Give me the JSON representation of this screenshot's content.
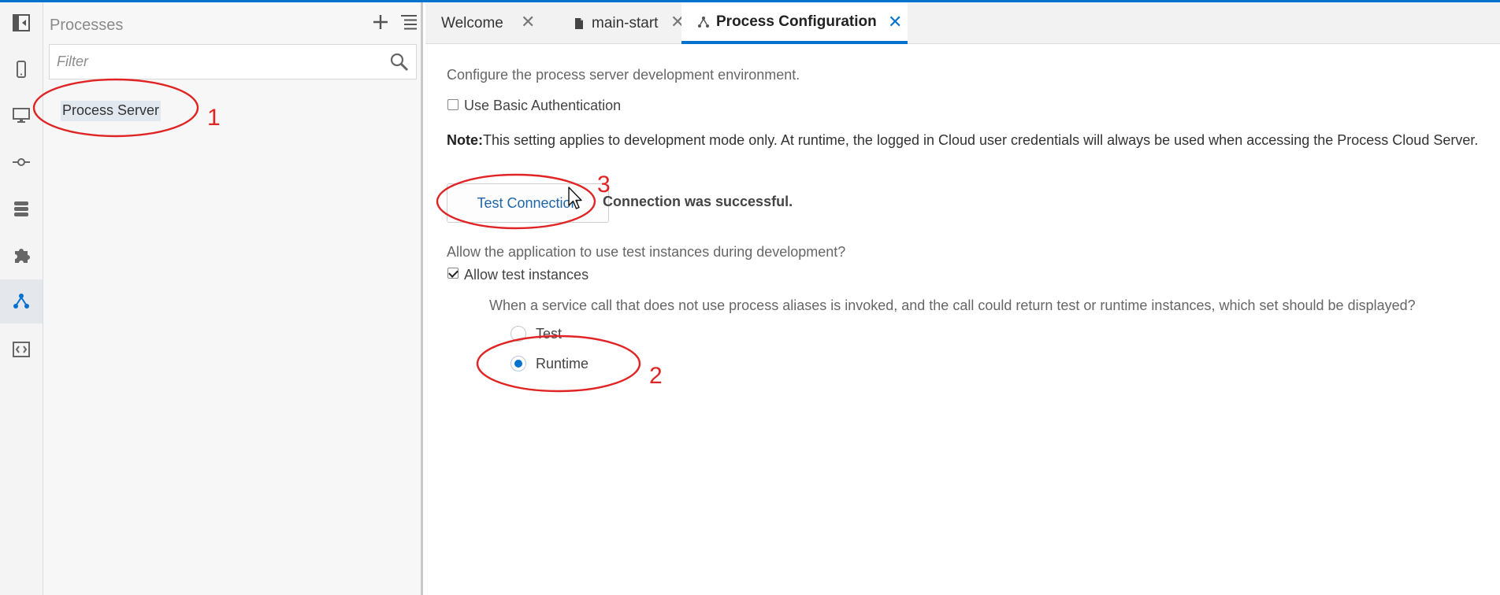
{
  "rail": {
    "items": [
      {
        "name": "toggle-panel-icon"
      },
      {
        "name": "mobile-icon"
      },
      {
        "name": "desktop-icon"
      },
      {
        "name": "service-icon"
      },
      {
        "name": "database-icon"
      },
      {
        "name": "puzzle-icon"
      },
      {
        "name": "processes-icon"
      },
      {
        "name": "code-icon"
      }
    ]
  },
  "panel": {
    "title": "Processes",
    "filter_placeholder": "Filter",
    "items": [
      {
        "label": "Process Server"
      }
    ]
  },
  "tabs": [
    {
      "label": "Welcome",
      "active": false
    },
    {
      "label": "main-start",
      "active": false
    },
    {
      "label": "Process Configuration",
      "active": true
    }
  ],
  "content": {
    "intro": "Configure the process server development environment.",
    "basic_auth_label": "Use Basic Authentication",
    "basic_auth_checked": false,
    "note_prefix": "Note:",
    "note_text": "This setting applies to development mode only. At runtime, the logged in Cloud user credentials will always be used when accessing the Process Cloud Server.",
    "test_button": "Test Connection",
    "connection_status": "Connection was successful.",
    "test_instances_question": "Allow the application to use test instances during development?",
    "allow_test_label": "Allow test instances",
    "allow_test_checked": true,
    "service_call_question": "When a service call that does not use process aliases is invoked, and the call could return test or runtime instances, which set should be displayed?",
    "radio_options": [
      {
        "label": "Test",
        "selected": false
      },
      {
        "label": "Runtime",
        "selected": true
      }
    ]
  },
  "annotations": [
    "1",
    "2",
    "3"
  ],
  "colors": {
    "accent": "#0572ce",
    "annotation": "#e02424"
  }
}
